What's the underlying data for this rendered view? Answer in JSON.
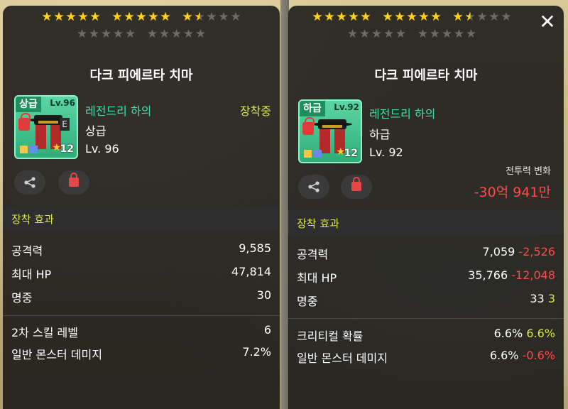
{
  "left_panel": {
    "stars_row1": [
      "full",
      "full",
      "full",
      "full",
      "full",
      "full",
      "full",
      "full",
      "full",
      "full",
      "full",
      "half",
      "empty",
      "empty",
      "empty"
    ],
    "stars_row2": [
      "empty",
      "empty",
      "empty",
      "empty",
      "empty",
      "empty",
      "empty",
      "empty",
      "empty",
      "empty"
    ],
    "title": "다크 피에르타 치마",
    "icon": {
      "grade": "상급",
      "level": "Lv.96",
      "star_count": "12"
    },
    "item_name": "레전드리 하의",
    "equipped_label": "장착중",
    "grade": "상급",
    "level": "Lv. 96",
    "section_title": "장착 효과",
    "stats": [
      {
        "label": "공격력",
        "value": "9,585"
      },
      {
        "label": "최대 HP",
        "value": "47,814"
      },
      {
        "label": "명중",
        "value": "30"
      }
    ],
    "extra_stats": [
      {
        "label": "2차 스킬 레벨",
        "value": "6"
      },
      {
        "label": "일반 몬스터 데미지",
        "value": "7.2%"
      }
    ]
  },
  "right_panel": {
    "stars_row1": [
      "full",
      "full",
      "full",
      "full",
      "full",
      "full",
      "full",
      "full",
      "full",
      "full",
      "full",
      "half",
      "empty",
      "empty",
      "empty"
    ],
    "stars_row2": [
      "empty",
      "empty",
      "empty",
      "empty",
      "empty",
      "empty",
      "empty",
      "empty",
      "empty",
      "empty"
    ],
    "title": "다크 피에르타 치마",
    "icon": {
      "grade": "하급",
      "level": "Lv.92",
      "star_count": "12"
    },
    "item_name": "레전드리 하의",
    "grade": "하급",
    "level": "Lv. 92",
    "power_change_label": "전투력 변화",
    "power_change_value": "-30억 941만",
    "section_title": "장착 효과",
    "stats": [
      {
        "label": "공격력",
        "value": "7,059",
        "delta": "-2,526",
        "delta_type": "neg"
      },
      {
        "label": "최대 HP",
        "value": "35,766",
        "delta": "-12,048",
        "delta_type": "neg"
      },
      {
        "label": "명중",
        "value": "33",
        "delta": "3",
        "delta_type": "pos"
      }
    ],
    "extra_stats": [
      {
        "label": "크리티컬 확률",
        "value": "6.6%",
        "delta": "6.6%",
        "delta_type": "pos"
      },
      {
        "label": "일반 몬스터 데미지",
        "value": "6.6%",
        "delta": "-0.6%",
        "delta_type": "neg"
      }
    ],
    "close_symbol": "✕"
  },
  "colors": {
    "panel_bg": "#141414",
    "accent_green": "#3ee1b0",
    "accent_yellow": "#d8e84a",
    "negative_red": "#ff4a4a",
    "star_gold": "#ffd21e"
  }
}
